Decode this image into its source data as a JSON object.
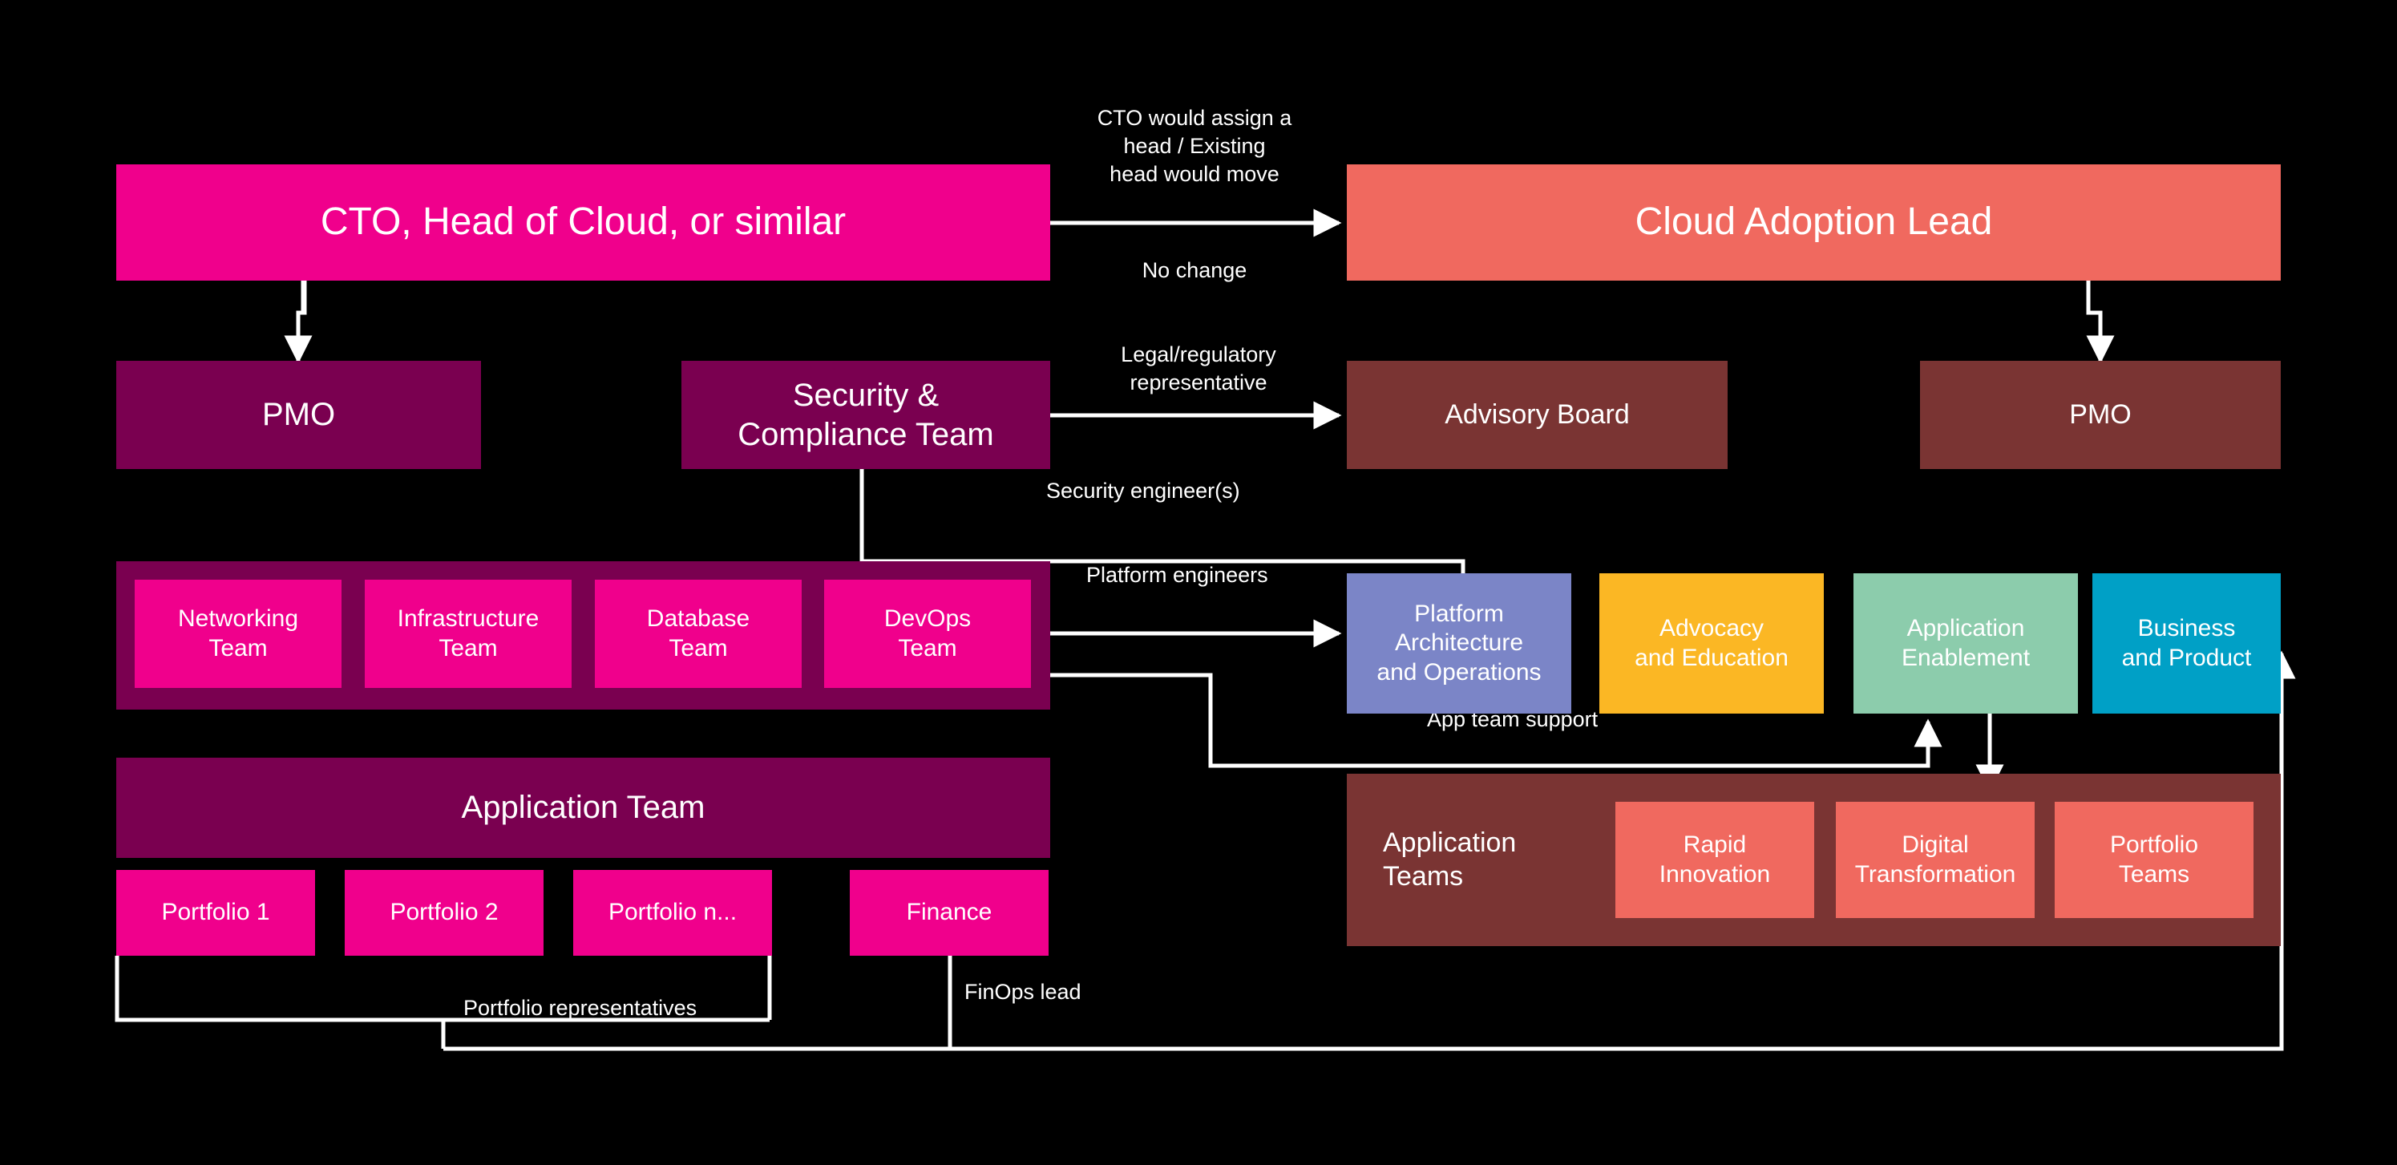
{
  "diagram": {
    "title": "Cloud operating model - current state to target state org chart",
    "background": "#000000",
    "palette": {
      "magenta": "#F0008C",
      "plum": "#7A0050",
      "salmon": "#F0695F",
      "brown": "#7A3433",
      "periwinkle": "#7B85C7",
      "amber": "#FBB724",
      "mint": "#8CCCAC",
      "cyan": "#00A0C6",
      "connector": "#FFFFFF"
    }
  },
  "nodes": {
    "cto": {
      "label": "CTO, Head of Cloud, or similar",
      "color": "#F0008C"
    },
    "cloud_adoption_lead": {
      "label": "Cloud Adoption Lead",
      "color": "#F0695F"
    },
    "pmo_left": {
      "label": "PMO",
      "color": "#7A0050"
    },
    "security_compliance": {
      "label": "Security &\nCompliance Team",
      "color": "#7A0050"
    },
    "advisory_board": {
      "label": "Advisory Board",
      "color": "#7A3433"
    },
    "pmo_right": {
      "label": "PMO",
      "color": "#7A3433"
    },
    "infra_group": {
      "label": "",
      "color": "#7A0050"
    },
    "networking_team": {
      "label": "Networking\nTeam",
      "color": "#F0008C"
    },
    "infrastructure_team": {
      "label": "Infrastructure\nTeam",
      "color": "#F0008C"
    },
    "database_team": {
      "label": "Database\nTeam",
      "color": "#F0008C"
    },
    "devops_team": {
      "label": "DevOps\nTeam",
      "color": "#F0008C"
    },
    "platform_arch_ops": {
      "label": "Platform\nArchitecture\nand Operations",
      "color": "#7B85C7"
    },
    "advocacy_education": {
      "label": "Advocacy\nand Education",
      "color": "#FBB724"
    },
    "application_enablement": {
      "label": "Application\nEnablement",
      "color": "#8CCCAC"
    },
    "business_product": {
      "label": "Business\nand Product",
      "color": "#00A0C6"
    },
    "application_team_group": {
      "label": "Application Team",
      "color": "#7A0050"
    },
    "portfolio_1": {
      "label": "Portfolio 1",
      "color": "#F0008C"
    },
    "portfolio_2": {
      "label": "Portfolio 2",
      "color": "#F0008C"
    },
    "portfolio_n": {
      "label": "Portfolio n...",
      "color": "#F0008C"
    },
    "finance": {
      "label": "Finance",
      "color": "#F0008C"
    },
    "application_teams_group": {
      "label": "Application\nTeams",
      "color": "#7A3433"
    },
    "rapid_innovation": {
      "label": "Rapid\nInnovation",
      "color": "#F0695F"
    },
    "digital_transformation": {
      "label": "Digital\nTransformation",
      "color": "#F0695F"
    },
    "portfolio_teams": {
      "label": "Portfolio\nTeams",
      "color": "#F0695F"
    }
  },
  "connector_labels": {
    "cto_assign": "CTO would assign a\nhead / Existing\nhead would move",
    "no_change": "No change",
    "legal_regulatory": "Legal/regulatory\nrepresentative",
    "security_engineers": "Security engineer(s)",
    "platform_engineers": "Platform engineers",
    "app_team_support": "App team support",
    "portfolio_representatives": "Portfolio representatives",
    "finops_lead": "FinOps lead"
  }
}
